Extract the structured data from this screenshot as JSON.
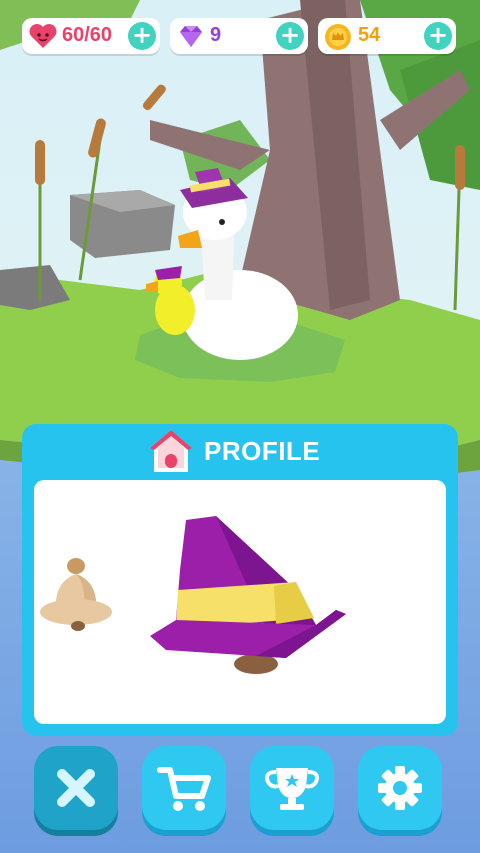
{
  "resources": {
    "hearts": {
      "value": "60/60",
      "icon": "heart-icon",
      "color": "#e8436a"
    },
    "gems": {
      "value": "9",
      "icon": "gem-icon",
      "color": "#9a3fd6"
    },
    "coins": {
      "value": "54",
      "icon": "coin-icon",
      "color": "#f2a10c"
    }
  },
  "profile": {
    "title": "PROFILE",
    "icon": "home-icon",
    "items": [
      {
        "name": "bell-hat",
        "icon": "bell-hat-icon"
      },
      {
        "name": "witch-hat",
        "icon": "witch-hat-icon",
        "selected": true
      }
    ]
  },
  "toolbar": [
    {
      "id": "close",
      "icon": "close-icon",
      "active": true
    },
    {
      "id": "shop",
      "icon": "cart-icon"
    },
    {
      "id": "trophies",
      "icon": "trophy-icon"
    },
    {
      "id": "settings",
      "icon": "gear-icon"
    }
  ],
  "colors": {
    "accent": "#2ec8f0",
    "plus": "#3fd3c0",
    "hat_purple": "#9b1fa8",
    "hat_band": "#f6e06a"
  }
}
